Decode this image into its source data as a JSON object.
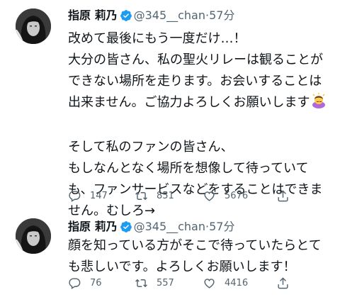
{
  "tweets": [
    {
      "name": "指原 莉乃",
      "handle_time": "@345__chan·57分",
      "lines": [
        "改めて最後にもう一度だけ…！",
        "大分の皆さん、私の聖火リレーは観ることが",
        "できない場所を走ります。お会いすることは",
        "出来ません。ご協力よろしくお願いします",
        "",
        "そして私のファンの皆さん、",
        "もしなんとなく場所を想像して待っていて",
        "も、ファンサービスなどをすることはできま",
        "せん。むしろ→"
      ],
      "reply_count": "147",
      "retweet_count": "851",
      "like_count": "5676"
    },
    {
      "name": "指原 莉乃",
      "handle_time": "@345__chan·57分",
      "lines": [
        "顔を知っている方がそこで待っていたらとて",
        "も悲しいです。よろしくお願いします！"
      ],
      "reply_count": "76",
      "retweet_count": "557",
      "like_count": "4416"
    }
  ],
  "colors": {
    "verified": "#1d9bf0",
    "secondary": "#536471",
    "text": "#0f1419"
  },
  "icons": [
    "verified-badge-icon",
    "reply-icon",
    "retweet-icon",
    "like-icon",
    "share-icon",
    "bowing-person-emoji"
  ]
}
